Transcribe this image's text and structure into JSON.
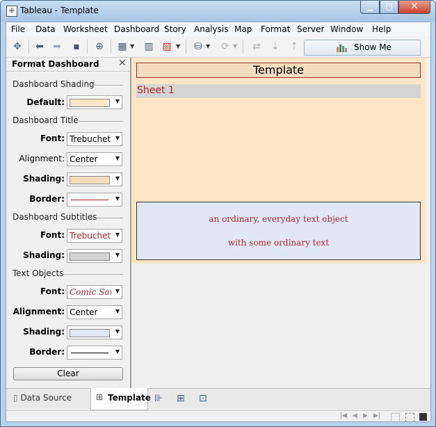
{
  "window": {
    "title": "Tableau - Template"
  },
  "menu": [
    "File",
    "Data",
    "Worksheet",
    "Dashboard",
    "Story",
    "Analysis",
    "Map",
    "Format",
    "Server",
    "Window",
    "Help"
  ],
  "toolbar": {
    "show_me_label": "Show Me"
  },
  "format_panel": {
    "title": "Format Dashboard",
    "sections": {
      "shading": "Dashboard Shading",
      "title": "Dashboard Title",
      "subtitles": "Dashboard Subtitles",
      "text_objects": "Text Objects"
    },
    "labels": {
      "default": "Default:",
      "font": "Font:",
      "alignment": "Alignment:",
      "shading": "Shading:",
      "border": "Border:"
    },
    "values": {
      "title_font": "Trebuchet MS",
      "title_alignment": "Center",
      "subtitle_font": "Trebuchet MS",
      "text_font": "Comic Sans MS",
      "text_alignment": "Center"
    },
    "colors": {
      "dashboard_shading": "#fde6c6",
      "title_shading": "#f4dcbe",
      "title_border": "#a22a2a",
      "subtitle_shading": "#d4d4d4",
      "text_shading": "#e2e7f7",
      "text_border": "#000000",
      "accent_text": "#b02828"
    },
    "clear_label": "Clear"
  },
  "dashboard": {
    "title": "Template",
    "sheet_title": "Sheet 1",
    "text_line_1": "an ordinary, everyday text object",
    "text_line_2": "with some ordinary text"
  },
  "tabs": {
    "data_source": "Data Source",
    "template": "Template"
  }
}
